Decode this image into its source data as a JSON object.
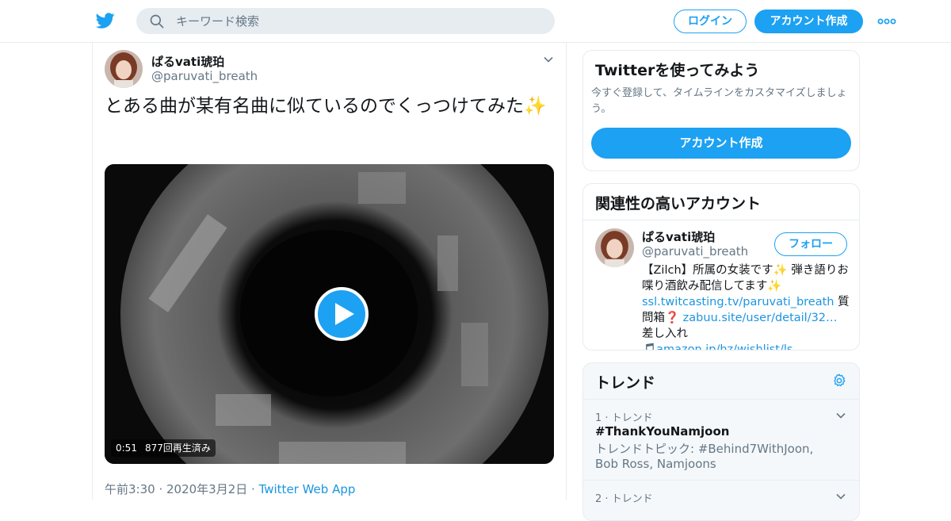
{
  "header": {
    "search_placeholder": "キーワード検索",
    "login_label": "ログイン",
    "signup_label": "アカウント作成"
  },
  "tweet": {
    "display_name": "ぱるvati琥珀",
    "handle": "@paruvati_breath",
    "text": "とある曲が某有名曲に似ているのでくっつけてみた✨",
    "video": {
      "duration": "0:51",
      "views": "877回再生済み"
    },
    "timestamp": "午前3:30 · 2020年3月2日 · ",
    "source": "Twitter Web App"
  },
  "signup_card": {
    "title": "Twitterを使ってみよう",
    "description": "今すぐ登録して、タイムラインをカスタマイズしましょう。",
    "button_label": "アカウント作成"
  },
  "related_card": {
    "title": "関連性の高いアカウント",
    "account": {
      "display_name": "ぱるvati琥珀",
      "handle": "@paruvati_breath",
      "follow_label": "フォロー",
      "bio_text_1": "【Zilch】所属の女装です✨ 弾き語りお喋り酒飲み配信してます✨ ",
      "bio_link_1": "ssl.twitcasting.tv/paruvati_breath",
      "bio_text_2": " 質問箱❓ ",
      "bio_link_2": "zabuu.site/user/detail/32…",
      "bio_text_3": " 差し入れ🎵",
      "bio_link_3": "amazon.jp/hz/wishlist/ls…"
    }
  },
  "trends_card": {
    "title": "トレンド",
    "items": [
      {
        "meta": "1 · トレンド",
        "name": "#ThankYouNamjoon",
        "topic": "トレンドトピック: #Behind7WithJoon, Bob Ross, Namjoons"
      },
      {
        "meta": "2 · トレンド",
        "name": "",
        "topic": ""
      }
    ]
  },
  "colors": {
    "brand": "#1da1f2",
    "link": "#1b95e0",
    "secondary_text": "#657786",
    "border": "#e6ecf0"
  },
  "icons": [
    "twitter-bird-icon",
    "search-icon",
    "more-dots-icon",
    "chevron-down-icon",
    "play-icon",
    "gear-icon"
  ]
}
